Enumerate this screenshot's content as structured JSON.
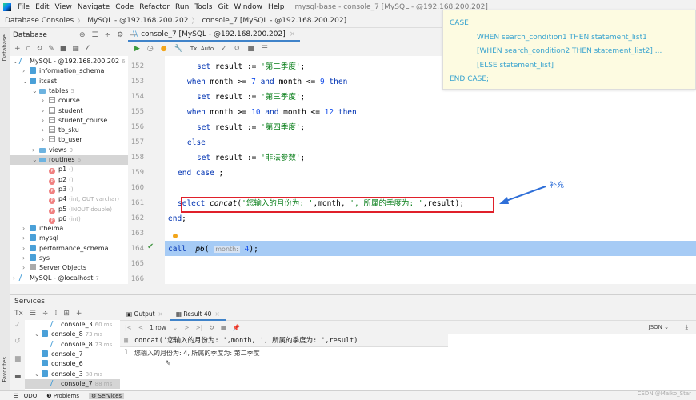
{
  "window": {
    "title": "mysql-base - console_7 [MySQL - @192.168.200.202]"
  },
  "menu": [
    "File",
    "Edit",
    "View",
    "Navigate",
    "Code",
    "Refactor",
    "Run",
    "Tools",
    "Git",
    "Window",
    "Help"
  ],
  "breadcrumb": [
    "Database Consoles",
    "MySQL - @192.168.200.202",
    "console_7 [MySQL - @192.168.200.202]"
  ],
  "db_panel": {
    "title": "Database",
    "strip_label": "Database",
    "tree": [
      {
        "label": "MySQL - @192.168.200.202",
        "hint": "6",
        "depth": 0,
        "icon": "conn",
        "chev": "v"
      },
      {
        "label": "information_schema",
        "depth": 1,
        "icon": "db",
        "chev": ">"
      },
      {
        "label": "itcast",
        "depth": 1,
        "icon": "db",
        "chev": "v"
      },
      {
        "label": "tables",
        "hint": "5",
        "depth": 2,
        "icon": "fold",
        "chev": "v"
      },
      {
        "label": "course",
        "depth": 3,
        "icon": "tbl",
        "chev": ">"
      },
      {
        "label": "student",
        "depth": 3,
        "icon": "tbl",
        "chev": ">"
      },
      {
        "label": "student_course",
        "depth": 3,
        "icon": "tbl",
        "chev": ">"
      },
      {
        "label": "tb_sku",
        "depth": 3,
        "icon": "tbl",
        "chev": ">"
      },
      {
        "label": "tb_user",
        "depth": 3,
        "icon": "tbl",
        "chev": ">"
      },
      {
        "label": "views",
        "hint": "9",
        "depth": 2,
        "icon": "fold",
        "chev": ">"
      },
      {
        "label": "routines",
        "hint": "6",
        "depth": 2,
        "icon": "fold",
        "chev": "v",
        "selected": true
      },
      {
        "label": "p1",
        "hint": "()",
        "depth": 3,
        "icon": "proc",
        "chev": ""
      },
      {
        "label": "p2",
        "hint": "()",
        "depth": 3,
        "icon": "proc",
        "chev": ""
      },
      {
        "label": "p3",
        "hint": "()",
        "depth": 3,
        "icon": "proc",
        "chev": ""
      },
      {
        "label": "p4",
        "hint": "(int, OUT varchar)",
        "depth": 3,
        "icon": "proc",
        "chev": ""
      },
      {
        "label": "p5",
        "hint": "(INOUT double)",
        "depth": 3,
        "icon": "proc",
        "chev": ""
      },
      {
        "label": "p6",
        "hint": "(int)",
        "depth": 3,
        "icon": "proc",
        "chev": ""
      },
      {
        "label": "itheima",
        "depth": 1,
        "icon": "db",
        "chev": ">"
      },
      {
        "label": "mysql",
        "depth": 1,
        "icon": "db",
        "chev": ">"
      },
      {
        "label": "performance_schema",
        "depth": 1,
        "icon": "db",
        "chev": ">"
      },
      {
        "label": "sys",
        "depth": 1,
        "icon": "db",
        "chev": ">"
      },
      {
        "label": "Server Objects",
        "depth": 1,
        "icon": "srv",
        "chev": ">"
      },
      {
        "label": "MySQL - @localhost",
        "hint": "7",
        "depth": 0,
        "icon": "conn",
        "chev": ">"
      }
    ]
  },
  "editor": {
    "tab": "console_7 [MySQL - @192.168.200.202]",
    "tx_mode": "Tx: Auto",
    "lines": [
      {
        "n": "152",
        "indent": 6,
        "tokens": [
          [
            "set",
            "k"
          ],
          [
            " result := ",
            "p"
          ],
          [
            "'第二季度'",
            "s"
          ],
          [
            ";",
            "p"
          ]
        ]
      },
      {
        "n": "153",
        "indent": 4,
        "tokens": [
          [
            "when",
            "k"
          ],
          [
            " month >= ",
            "p"
          ],
          [
            "7",
            "n"
          ],
          [
            " ",
            "p"
          ],
          [
            "and",
            "k"
          ],
          [
            " month <= ",
            "p"
          ],
          [
            "9",
            "n"
          ],
          [
            " ",
            "p"
          ],
          [
            "then",
            "k"
          ]
        ]
      },
      {
        "n": "154",
        "indent": 6,
        "tokens": [
          [
            "set",
            "k"
          ],
          [
            " result := ",
            "p"
          ],
          [
            "'第三季度'",
            "s"
          ],
          [
            ";",
            "p"
          ]
        ]
      },
      {
        "n": "155",
        "indent": 4,
        "tokens": [
          [
            "when",
            "k"
          ],
          [
            " month >= ",
            "p"
          ],
          [
            "10",
            "n"
          ],
          [
            " ",
            "p"
          ],
          [
            "and",
            "k"
          ],
          [
            " month <= ",
            "p"
          ],
          [
            "12",
            "n"
          ],
          [
            " ",
            "p"
          ],
          [
            "then",
            "k"
          ]
        ]
      },
      {
        "n": "156",
        "indent": 6,
        "tokens": [
          [
            "set",
            "k"
          ],
          [
            " result := ",
            "p"
          ],
          [
            "'第四季度'",
            "s"
          ],
          [
            ";",
            "p"
          ]
        ]
      },
      {
        "n": "157",
        "indent": 4,
        "tokens": [
          [
            "else",
            "k"
          ]
        ]
      },
      {
        "n": "158",
        "indent": 6,
        "tokens": [
          [
            "set",
            "k"
          ],
          [
            " result := ",
            "p"
          ],
          [
            "'非法参数'",
            "s"
          ],
          [
            ";",
            "p"
          ]
        ]
      },
      {
        "n": "159",
        "indent": 2,
        "tokens": [
          [
            "end",
            "k"
          ],
          [
            " ",
            "p"
          ],
          [
            "case",
            "k"
          ],
          [
            " ;",
            "p"
          ]
        ]
      },
      {
        "n": "160",
        "indent": 0,
        "tokens": []
      },
      {
        "n": "161",
        "indent": 2,
        "tokens": [
          [
            "select",
            "k"
          ],
          [
            " ",
            "p"
          ],
          [
            "concat",
            "f"
          ],
          [
            "(",
            "p"
          ],
          [
            "'您输入的月份为: '",
            "s"
          ],
          [
            ",month, ",
            "p"
          ],
          [
            "', 所属的季度为: '",
            "s"
          ],
          [
            ",result);",
            "p"
          ]
        ]
      },
      {
        "n": "162",
        "indent": 0,
        "tokens": [
          [
            "end",
            "k"
          ],
          [
            ";",
            "p"
          ]
        ]
      },
      {
        "n": "163",
        "indent": 0,
        "tokens": []
      },
      {
        "n": "164",
        "indent": 0,
        "tokens": [
          [
            "call",
            "k"
          ],
          [
            "  ",
            "p"
          ],
          [
            "p6",
            "f"
          ],
          [
            "( ",
            "p"
          ],
          [
            "month:",
            "h"
          ],
          [
            " ",
            "p"
          ],
          [
            "4",
            "n"
          ],
          [
            ");",
            "p"
          ]
        ]
      },
      {
        "n": "165",
        "indent": 0,
        "tokens": []
      },
      {
        "n": "166",
        "indent": 0,
        "tokens": []
      }
    ]
  },
  "tooltip": {
    "lines": [
      "CASE",
      "WHEN  search_condition1  THEN  statement_list1",
      "[WHEN  search_condition2  THEN  statement_list2] ...",
      "[ELSE  statement_list]",
      "END CASE;"
    ]
  },
  "annotation": {
    "text": "补充",
    "color": "#2f6fd8"
  },
  "services": {
    "title": "Services",
    "favorites_label": "Favorites",
    "tree": [
      {
        "label": "console_3",
        "ms": "60 ms",
        "depth": 2,
        "chev": ""
      },
      {
        "label": "console_8",
        "ms": "73 ms",
        "depth": 1,
        "chev": "v"
      },
      {
        "label": "console_8",
        "ms": "73 ms",
        "depth": 2,
        "chev": ""
      },
      {
        "label": "console_7",
        "depth": 1,
        "chev": ""
      },
      {
        "label": "console_6",
        "depth": 1,
        "chev": ""
      },
      {
        "label": "console_3",
        "ms": "88 ms",
        "depth": 1,
        "chev": "v"
      },
      {
        "label": "console_7",
        "ms": "88 ms",
        "depth": 2,
        "chev": "",
        "selected": true
      }
    ],
    "tabs": [
      {
        "label": "Output"
      },
      {
        "label": "Result 40",
        "active": true
      }
    ],
    "rows_label": "1 row",
    "format": "JSON",
    "column": "concat('您输入的月份为: ',month, ', 所属的季度为: ',result)",
    "rows": [
      {
        "n": "1",
        "value": "您输入的月份为: 4, 所属的季度为: 第二季度"
      }
    ]
  },
  "bottom_tabs": [
    {
      "label": "TODO"
    },
    {
      "label": "Problems"
    },
    {
      "label": "Services",
      "active": true
    }
  ],
  "watermark": "CSDN @Maiko_Star",
  "colors": {
    "keyword": "#0033b3",
    "string": "#067d17",
    "number": "#1750eb",
    "selection": "#a6cbf5",
    "highlight_box": "#e0202a",
    "tooltip_bg": "#fdfbe1",
    "tooltip_text": "#38a3cf"
  }
}
